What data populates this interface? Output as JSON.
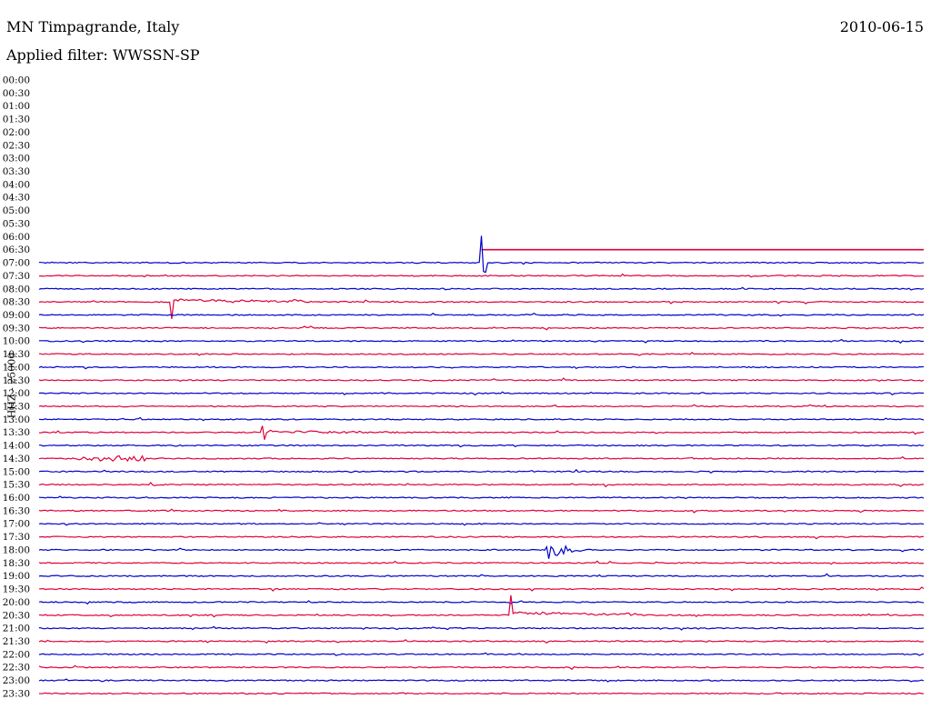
{
  "header": {
    "title": "MN Timpagrande, Italy",
    "date": "2010-06-15",
    "filter": "Applied filter: WWSSN-SP"
  },
  "chart_data": {
    "type": "line",
    "title": "MN Timpagrande, Italy",
    "ylabel": "HHZ - 25000",
    "row_labels": [
      "00:00",
      "00:30",
      "01:00",
      "01:30",
      "02:00",
      "02:30",
      "03:00",
      "03:30",
      "04:00",
      "04:30",
      "05:00",
      "05:30",
      "06:00",
      "06:30",
      "07:00",
      "07:30",
      "08:00",
      "08:30",
      "09:00",
      "09:30",
      "10:00",
      "10:30",
      "11:00",
      "11:30",
      "12:00",
      "12:30",
      "13:00",
      "13:30",
      "14:00",
      "14:30",
      "15:00",
      "15:30",
      "16:00",
      "16:30",
      "17:00",
      "17:30",
      "18:00",
      "18:30",
      "19:00",
      "19:30",
      "20:00",
      "20:30",
      "21:00",
      "21:30",
      "22:00",
      "22:30",
      "23:00",
      "23:30"
    ],
    "trace_colors": [
      "#0000cc",
      "#e0003a"
    ],
    "first_trace_row": "07:00",
    "row_duration_minutes": 30,
    "x_range_minutes": [
      0,
      30
    ],
    "events": [
      {
        "row": "07:00",
        "minute": 15.0,
        "amplitude": 1.0,
        "type": "step_start"
      },
      {
        "row": "06:30",
        "minute": 15.0,
        "amplitude": 0.0,
        "type": "flatline_after"
      },
      {
        "row": "08:30",
        "minute": 4.5,
        "amplitude": 0.85,
        "type": "spike"
      },
      {
        "row": "13:30",
        "minute": 7.6,
        "amplitude": 0.35,
        "type": "spike"
      },
      {
        "row": "14:30",
        "minute": 2.5,
        "amplitude": 0.12,
        "type": "burst"
      },
      {
        "row": "18:00",
        "minute": 17.2,
        "amplitude": 1.0,
        "type": "earthquake"
      },
      {
        "row": "20:30",
        "minute": 16.0,
        "amplitude": 1.0,
        "type": "spike"
      }
    ]
  }
}
